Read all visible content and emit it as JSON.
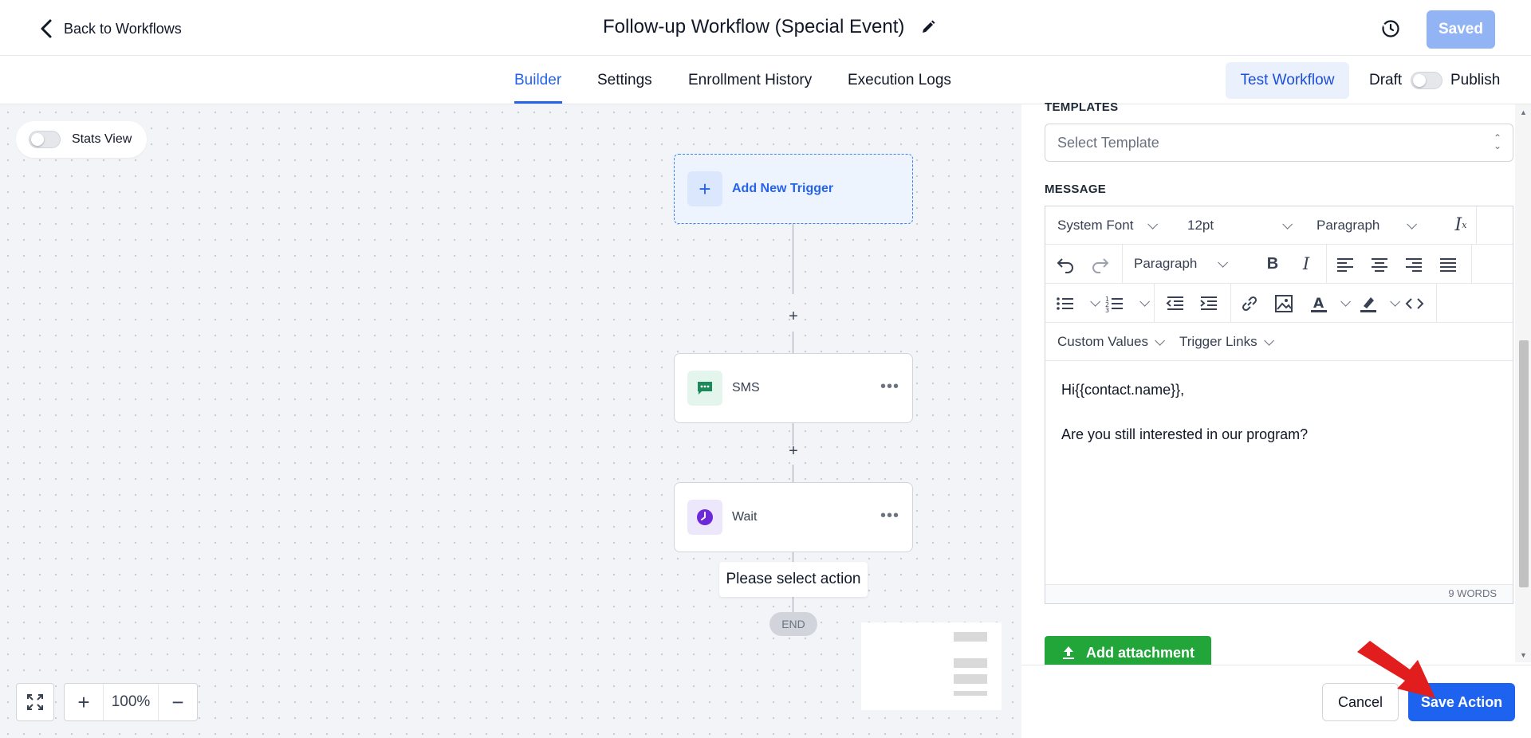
{
  "header": {
    "back_label": "Back to Workflows",
    "title": "Follow-up Workflow (Special Event)",
    "saved_label": "Saved"
  },
  "tabs": [
    {
      "label": "Builder",
      "active": true
    },
    {
      "label": "Settings",
      "active": false
    },
    {
      "label": "Enrollment History",
      "active": false
    },
    {
      "label": "Execution Logs",
      "active": false
    }
  ],
  "actions": {
    "test_workflow": "Test Workflow",
    "draft_label": "Draft",
    "publish_label": "Publish"
  },
  "canvas": {
    "stats_view_label": "Stats View",
    "trigger_label": "Add New Trigger",
    "nodes": [
      {
        "label": "SMS",
        "icon": "sms-icon",
        "color": "#1a8a5a"
      },
      {
        "label": "Wait",
        "icon": "clock-icon",
        "color": "#7c3aed"
      }
    ],
    "tooltip": "Please select action",
    "end_label": "END",
    "zoom_level": "100%"
  },
  "panel": {
    "templates_label": "TEMPLATES",
    "template_placeholder": "Select Template",
    "message_label": "MESSAGE",
    "toolbar": {
      "font": "System Font",
      "size": "12pt",
      "block": "Paragraph",
      "block2": "Paragraph",
      "custom_values": "Custom Values",
      "trigger_links": "Trigger Links"
    },
    "message_lines": [
      "Hi{{contact.name}},",
      "Are you still interested in our program?"
    ],
    "word_count": "9 WORDS",
    "attachment_label": "Add attachment",
    "cancel_label": "Cancel",
    "save_label": "Save Action"
  },
  "colors": {
    "accent": "#2563eb",
    "save_button": "#1d63f0",
    "attach_button": "#22a63a",
    "saved_disabled": "#93b4f4"
  }
}
